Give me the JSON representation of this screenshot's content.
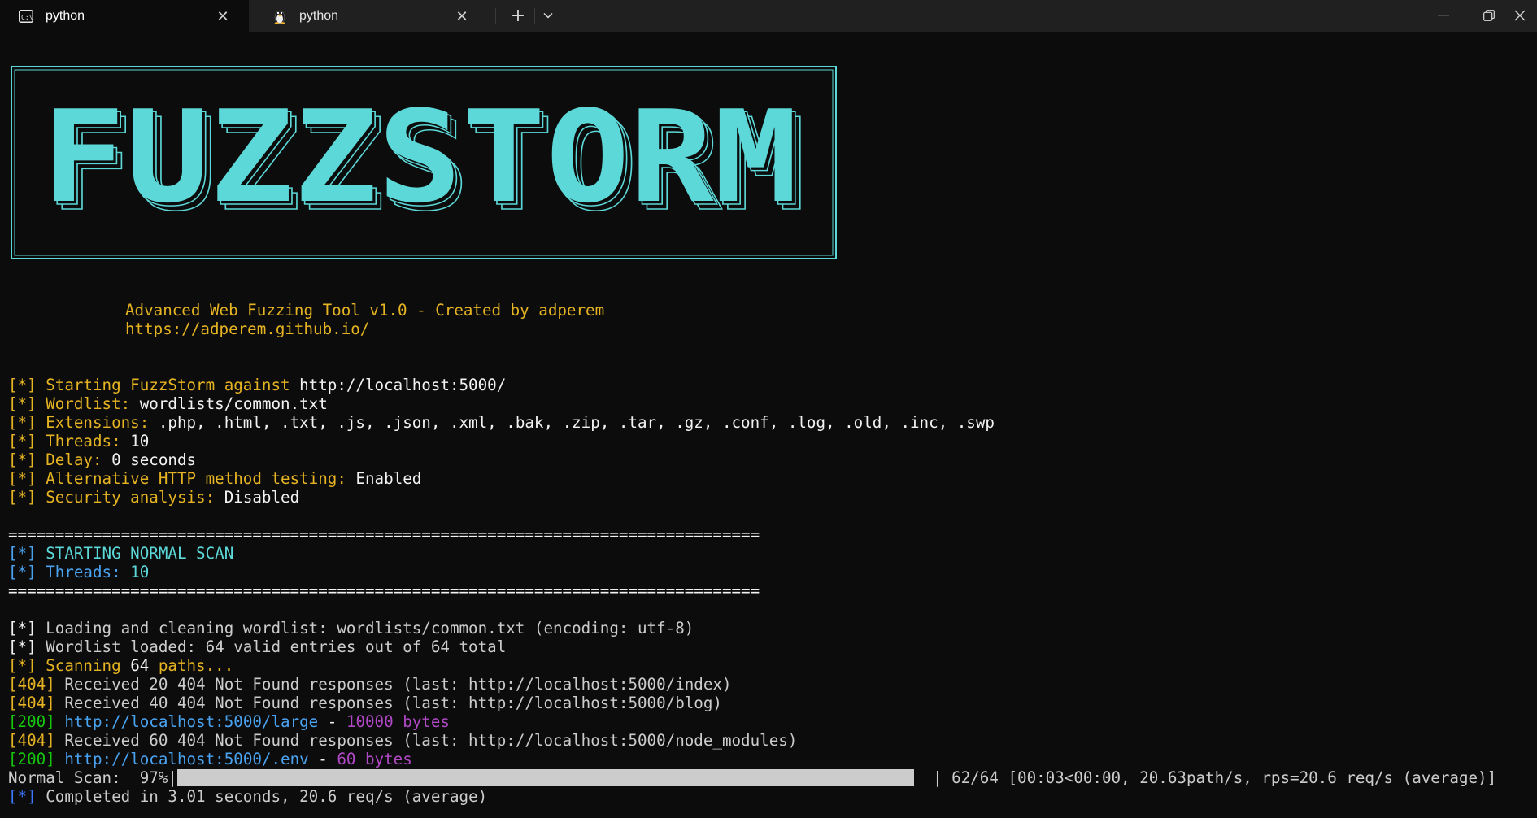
{
  "window": {
    "tabs": [
      {
        "label": "python",
        "icon": "cmd-icon",
        "active": true
      },
      {
        "label": "python",
        "icon": "linux-penguin-icon",
        "active": false
      }
    ],
    "controls": {
      "new_tab": "+",
      "dropdown": "⌄",
      "minimize": "—",
      "maximize": "⧉",
      "close": "✕"
    }
  },
  "banner": {
    "logo_text": "FUZZSTORM",
    "logo_color": "#5dd8d8",
    "tagline": "Advanced Web Fuzzing Tool v1.0 - Created by adperem",
    "url": "https://adperem.github.io/"
  },
  "config": [
    {
      "prefix": "[*]",
      "label": "Starting FuzzStorm against ",
      "value": "http://localhost:5000/",
      "suffix": ""
    },
    {
      "prefix": "[*]",
      "label": "Wordlist: ",
      "value": "wordlists/common.txt",
      "suffix": ""
    },
    {
      "prefix": "[*]",
      "label": "Extensions: ",
      "value": ".php, .html, .txt, .js, .json, .xml, .bak, .zip, .tar, .gz, .conf, .log, .old, .inc, .swp",
      "suffix": ""
    },
    {
      "prefix": "[*]",
      "label": "Threads: ",
      "value": "10",
      "suffix": ""
    },
    {
      "prefix": "[*]",
      "label": "Delay: ",
      "value": "0",
      "suffix": " seconds"
    },
    {
      "prefix": "[*]",
      "label": "Alternative HTTP method testing: ",
      "value": "Enabled",
      "suffix": ""
    },
    {
      "prefix": "[*]",
      "label": "Security analysis: ",
      "value": "Disabled",
      "suffix": ""
    }
  ],
  "separator": "================================================================================",
  "scan_header": {
    "title_prefix": "[*]",
    "title": "STARTING NORMAL SCAN",
    "threads_prefix": "[*]",
    "threads_label": "Threads: ",
    "threads_value": "10"
  },
  "log": {
    "loading": {
      "prefix": "[*]",
      "text": "Loading and cleaning wordlist: wordlists/common.txt (encoding: utf-8)"
    },
    "loaded": {
      "prefix": "[*]",
      "text": "Wordlist loaded: 64 valid entries out of 64 total"
    },
    "scanning": {
      "prefix": "[*]",
      "label": "Scanning ",
      "count": "64",
      "suffix": " paths..."
    },
    "r404_1": {
      "code": "[404]",
      "text": "Received 20 404 Not Found responses (last: http://localhost:5000/index)"
    },
    "r404_2": {
      "code": "[404]",
      "text": "Received 40 404 Not Found responses (last: http://localhost:5000/blog)"
    },
    "r200_1": {
      "code": "[200]",
      "url": "http://localhost:5000/large",
      "sep": " - ",
      "size": "10000 bytes"
    },
    "r404_3": {
      "code": "[404]",
      "text": "Received 60 404 Not Found responses (last: http://localhost:5000/node_modules)"
    },
    "r200_2": {
      "code": "[200]",
      "url": "http://localhost:5000/.env",
      "sep": " - ",
      "size": "60 bytes"
    }
  },
  "progress": {
    "label": "Normal Scan:  97%|",
    "percent": 97,
    "stats": "| 62/64 [00:03<00:00, 20.63path/s, rps=20.6 req/s (average)]"
  },
  "completed": {
    "prefix": "[*]",
    "text": "Completed in 3.01 seconds, 20.6 req/s (average)"
  }
}
